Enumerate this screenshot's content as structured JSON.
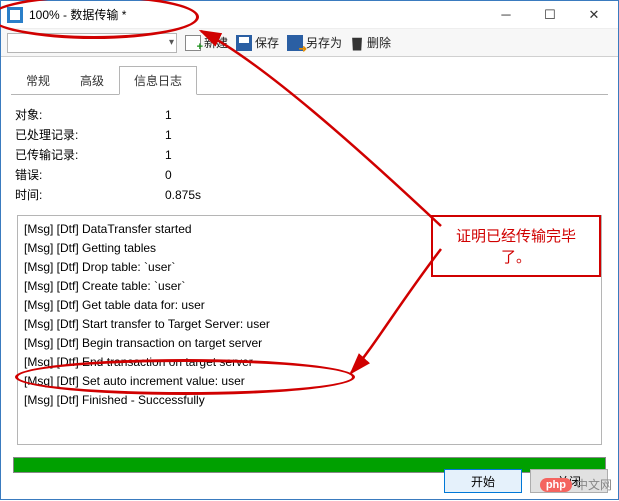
{
  "window": {
    "title": "100% - 数据传输 *"
  },
  "toolbar": {
    "new_label": "新建",
    "save_label": "保存",
    "saveas_label": "另存为",
    "delete_label": "删除"
  },
  "tabs": {
    "general": "常规",
    "advanced": "高级",
    "log": "信息日志"
  },
  "stats": {
    "object_label": "对象:",
    "object_value": "1",
    "processed_label": "已处理记录:",
    "processed_value": "1",
    "transferred_label": "已传输记录:",
    "transferred_value": "1",
    "errors_label": "错误:",
    "errors_value": "0",
    "time_label": "时间:",
    "time_value": "0.875s"
  },
  "log": {
    "lines": [
      "[Msg] [Dtf] DataTransfer started",
      "[Msg] [Dtf] Getting tables",
      "[Msg] [Dtf] Drop table: `user`",
      "[Msg] [Dtf] Create table: `user`",
      "[Msg] [Dtf] Get table data for: user",
      "[Msg] [Dtf] Start transfer to Target Server: user",
      "[Msg] [Dtf] Begin transaction on target server",
      "[Msg] [Dtf] End transaction on target server",
      "[Msg] [Dtf] Set auto increment value: user",
      "[Msg] [Dtf] Finished - Successfully"
    ],
    "l0": "[Msg] [Dtf] DataTransfer started",
    "l1": "[Msg] [Dtf] Getting tables",
    "l2": "[Msg] [Dtf] Drop table: `user`",
    "l3": "[Msg] [Dtf] Create table: `user`",
    "l4": "[Msg] [Dtf] Get table data for: user",
    "l5": "[Msg] [Dtf] Start transfer to Target Server: user",
    "l6": "[Msg] [Dtf] Begin transaction on target server",
    "l7": "[Msg] [Dtf] End transaction on target server",
    "l8": "[Msg] [Dtf] Set auto increment value: user",
    "l9": "[Msg] [Dtf] Finished - Successfully"
  },
  "footer": {
    "start_label": "开始",
    "close_label": "关闭"
  },
  "annotation": {
    "note": "证明已经传输完毕了。"
  },
  "watermark": {
    "badge": "php",
    "text": "中文网"
  }
}
